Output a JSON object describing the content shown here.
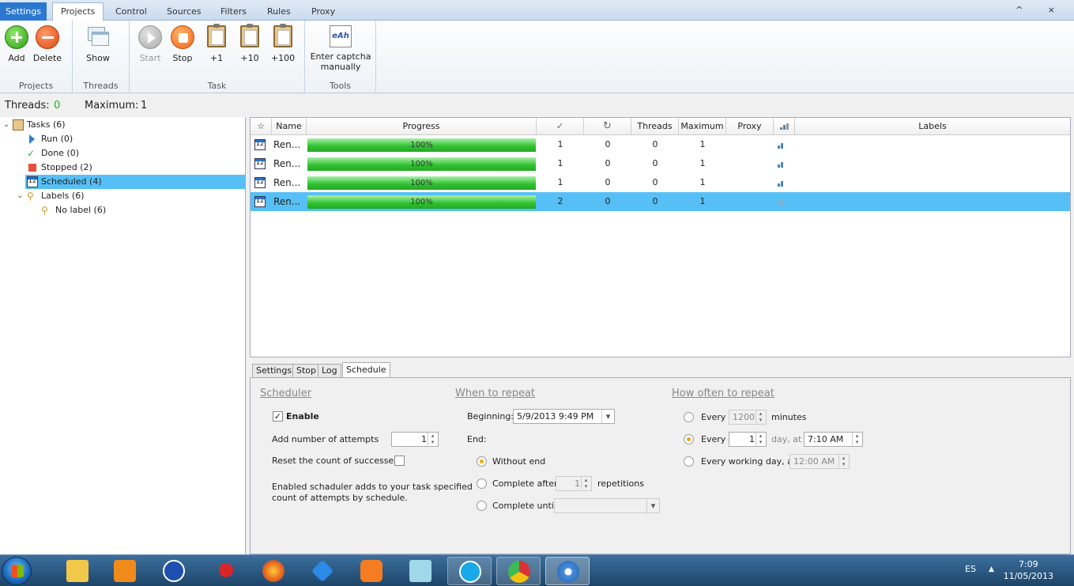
{
  "ribbon_tabs": [
    "Settings",
    "Projects",
    "Control",
    "Sources",
    "Filters",
    "Rules",
    "Proxy"
  ],
  "window_controls": "^ ×",
  "ribbon": {
    "groups": {
      "projects": "Projects",
      "threads": "Threads",
      "task": "Task",
      "tools": "Tools"
    },
    "buttons": {
      "add": "Add",
      "delete": "Delete",
      "show": "Show",
      "start": "Start",
      "stop": "Stop",
      "plus1": "+1",
      "plus10": "+10",
      "plus100": "+100",
      "captcha_line1": "Enter captcha",
      "captcha_line2": "manually"
    },
    "captcha_icon_text": "eAh"
  },
  "status": {
    "threads_label": "Threads:",
    "threads_value": "0",
    "maximum_label": "Maximum:",
    "maximum_value": "1"
  },
  "tree": {
    "tasks": "Tasks (6)",
    "run": "Run (0)",
    "done": "Done (0)",
    "stopped": "Stopped (2)",
    "scheduled": "Scheduled (4)",
    "labels": "Labels (6)",
    "no_label": "No label (6)"
  },
  "grid": {
    "headers": {
      "star": "☆",
      "name": "Name",
      "progress": "Progress",
      "success": "✓",
      "retry": "↻",
      "threads": "Threads",
      "maximum": "Maximum",
      "proxy": "Proxy",
      "labels": "Labels"
    },
    "rows": [
      {
        "name": "Ren...",
        "progress": "100%",
        "progress_value": 100,
        "success": "1",
        "retry": "0",
        "threads": "0",
        "maximum": "1",
        "proxy": "",
        "label": ""
      },
      {
        "name": "Ren...",
        "progress": "100%",
        "progress_value": 100,
        "success": "1",
        "retry": "0",
        "threads": "0",
        "maximum": "1",
        "proxy": "",
        "label": ""
      },
      {
        "name": "Ren...",
        "progress": "100%",
        "progress_value": 100,
        "success": "1",
        "retry": "0",
        "threads": "0",
        "maximum": "1",
        "proxy": "",
        "label": ""
      },
      {
        "name": "Ren...",
        "progress": "100%",
        "progress_value": 100,
        "success": "2",
        "retry": "0",
        "threads": "0",
        "maximum": "1",
        "proxy": "",
        "label": ""
      }
    ],
    "calendar_day": "12"
  },
  "bottom_tabs": [
    "Settings",
    "Stop",
    "Log",
    "Schedule"
  ],
  "schedule": {
    "scheduler": {
      "title": "Scheduler",
      "enable": "Enable",
      "add_attempts": "Add number of attempts",
      "attempts_value": "1",
      "reset_count": "Reset the count of successes",
      "note_line1": "Enabled schaduler adds to your task specified",
      "note_line2": "count of attempts by schedule."
    },
    "when": {
      "title": "When to repeat",
      "beginning_label": "Beginning:",
      "beginning_value": "5/9/2013 9:49 PM",
      "end_label": "End:",
      "without_end": "Without end",
      "complete_after": "Complete after",
      "repetitions_value": "1",
      "repetitions": "repetitions",
      "complete_until": "Complete untill"
    },
    "how": {
      "title": "How often to repeat",
      "every": "Every",
      "minutes_value": "1200",
      "minutes": "minutes",
      "every2": "Every",
      "day_value": "1",
      "day_at": "day, at",
      "time_value": "7:10 AM",
      "working_day": "Every working day, at",
      "working_time": "12:00 AM"
    }
  },
  "taskbar": {
    "lang": "ES",
    "time": "7:09",
    "date": "11/05/2013"
  },
  "colors": {
    "selection": "#56c0f6",
    "progress": "#2ec02e",
    "ribbon_tab_blue": "#2b78d1"
  }
}
